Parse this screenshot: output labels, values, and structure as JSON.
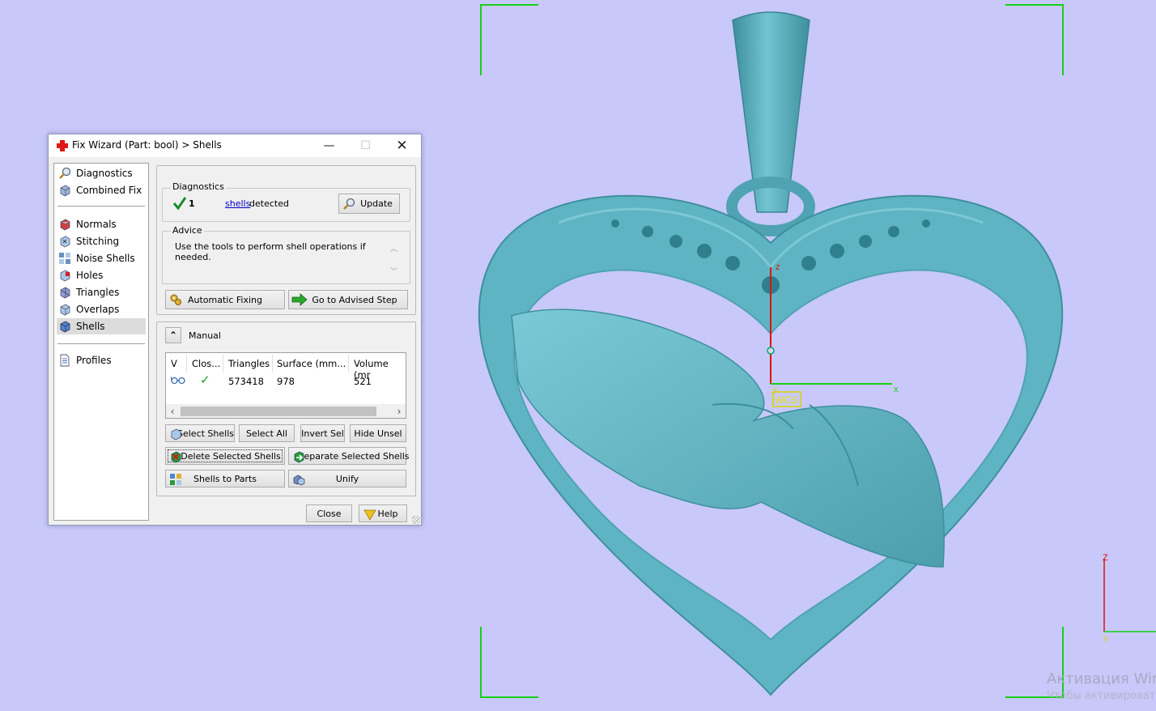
{
  "window": {
    "title": "Fix Wizard (Part: bool) > Shells",
    "controls": {
      "minimize": "—",
      "maximize": "☐",
      "close": "✕"
    }
  },
  "sidebar": {
    "items": [
      {
        "label": "Diagnostics",
        "icon": "magnifier-icon"
      },
      {
        "label": "Combined Fix",
        "icon": "cube-icon"
      },
      {
        "label": "Normals",
        "icon": "normals-cube-icon"
      },
      {
        "label": "Stitching",
        "icon": "stitching-cube-icon"
      },
      {
        "label": "Noise Shells",
        "icon": "noise-shells-icon"
      },
      {
        "label": "Holes",
        "icon": "holes-cube-icon"
      },
      {
        "label": "Triangles",
        "icon": "triangles-cube-icon"
      },
      {
        "label": "Overlaps",
        "icon": "overlaps-cube-icon"
      },
      {
        "label": "Shells",
        "icon": "shells-cube-icon",
        "selected": true
      },
      {
        "label": "Profiles",
        "icon": "document-icon"
      }
    ]
  },
  "diagnostics": {
    "label": "Diagnostics",
    "count": "1",
    "link": "shells",
    "text": "detected",
    "update_button": "Update"
  },
  "advice": {
    "label": "Advice",
    "text": "Use the tools to perform shell operations if needed."
  },
  "actions": {
    "automatic_fixing": "Automatic Fixing",
    "go_advised_step": "Go to Advised Step"
  },
  "manual": {
    "label": "Manual",
    "collapse_glyph": "⌃"
  },
  "table": {
    "columns": [
      "V",
      "Clos...",
      "Triangles",
      "Surface (mm...",
      "Volume (mr"
    ],
    "rows": [
      {
        "visible_icon": "glasses-icon",
        "closed": "✓",
        "triangles": "573418",
        "surface": "978",
        "volume": "521"
      }
    ]
  },
  "buttons": {
    "select_shells": "Select Shells",
    "select_all": "Select All",
    "invert_sel": "Invert Sel",
    "hide_unsel": "Hide Unsel",
    "delete_selected": "Delete Selected Shells",
    "separate_selected": "Separate Selected Shells",
    "shells_to_parts": "Shells to Parts",
    "unify": "Unify",
    "close": "Close",
    "help": "Help"
  },
  "viewport": {
    "wcs_label": "WCS",
    "model_axes": {
      "x": "x",
      "y": "y",
      "z": "z"
    },
    "mini_axes": {
      "z": "Z",
      "y": "Y"
    },
    "watermark_line1": "Активация Win",
    "watermark_line2": "Чтобы активироват"
  },
  "colors": {
    "background": "#c8c8fa",
    "model": "#5fb4c4",
    "corner_brackets": "#16d016",
    "axis_x": "#16d016",
    "axis_z": "#e01010"
  }
}
